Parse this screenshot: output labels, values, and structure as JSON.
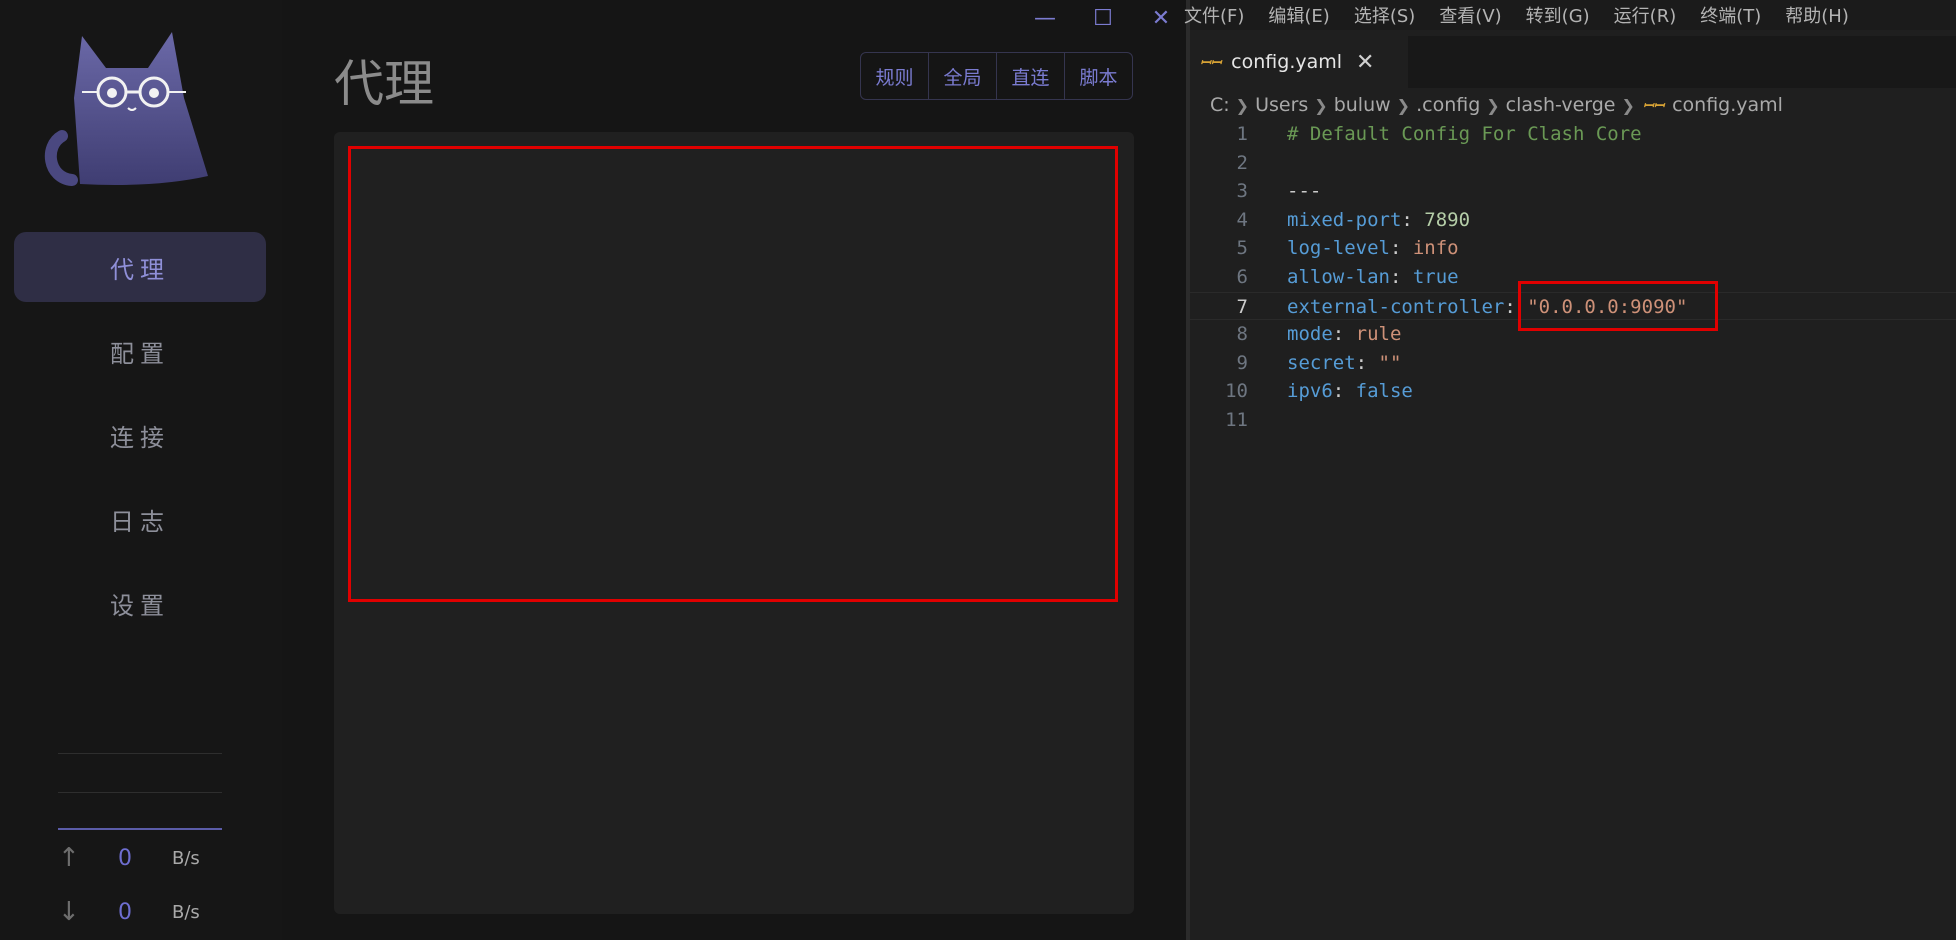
{
  "clash": {
    "window_controls": [
      "—",
      "☐",
      "✕"
    ],
    "nav": [
      {
        "label": "代理",
        "active": true
      },
      {
        "label": "配置",
        "active": false
      },
      {
        "label": "连接",
        "active": false
      },
      {
        "label": "日志",
        "active": false
      },
      {
        "label": "设置",
        "active": false
      }
    ],
    "traffic": {
      "upload": {
        "arrow": "↑",
        "value": "0",
        "unit": "B/s"
      },
      "download": {
        "arrow": "↓",
        "value": "0",
        "unit": "B/s"
      }
    },
    "page_title": "代理",
    "modes": [
      "规则",
      "全局",
      "直连",
      "脚本"
    ],
    "colors": {
      "accent": "#7a7bd0",
      "highlight": "#e00000"
    }
  },
  "vscode": {
    "menu": [
      "文件(F)",
      "编辑(E)",
      "选择(S)",
      "查看(V)",
      "转到(G)",
      "运行(R)",
      "终端(T)",
      "帮助(H)"
    ],
    "tab": {
      "icon": "yml-icon",
      "label": "config.yaml",
      "close": "✕"
    },
    "breadcrumb": [
      "C:",
      "Users",
      "buluw",
      ".config",
      "clash-verge",
      "config.yaml"
    ],
    "code": [
      {
        "n": "1",
        "tokens": [
          {
            "t": "# Default Config For Clash Core",
            "c": "comment"
          }
        ]
      },
      {
        "n": "2",
        "tokens": []
      },
      {
        "n": "3",
        "tokens": [
          {
            "t": "---",
            "c": "plain"
          }
        ]
      },
      {
        "n": "4",
        "tokens": [
          {
            "t": "mixed-port",
            "c": "key"
          },
          {
            "t": ": ",
            "c": "plain"
          },
          {
            "t": "7890",
            "c": "num"
          }
        ]
      },
      {
        "n": "5",
        "tokens": [
          {
            "t": "log-level",
            "c": "key"
          },
          {
            "t": ": ",
            "c": "plain"
          },
          {
            "t": "info",
            "c": "str"
          }
        ]
      },
      {
        "n": "6",
        "tokens": [
          {
            "t": "allow-lan",
            "c": "key"
          },
          {
            "t": ": ",
            "c": "plain"
          },
          {
            "t": "true",
            "c": "kw"
          }
        ]
      },
      {
        "n": "7",
        "tokens": [
          {
            "t": "external-controller",
            "c": "key"
          },
          {
            "t": ": ",
            "c": "plain"
          },
          {
            "t": "\"0.0.0.0:9090\"",
            "c": "str"
          }
        ],
        "current": true
      },
      {
        "n": "8",
        "tokens": [
          {
            "t": "mode",
            "c": "key"
          },
          {
            "t": ": ",
            "c": "plain"
          },
          {
            "t": "rule",
            "c": "str"
          }
        ]
      },
      {
        "n": "9",
        "tokens": [
          {
            "t": "secret",
            "c": "key"
          },
          {
            "t": ": ",
            "c": "plain"
          },
          {
            "t": "\"\"",
            "c": "str"
          }
        ]
      },
      {
        "n": "10",
        "tokens": [
          {
            "t": "ipv6",
            "c": "key"
          },
          {
            "t": ": ",
            "c": "plain"
          },
          {
            "t": "false",
            "c": "kw"
          }
        ]
      },
      {
        "n": "11",
        "tokens": []
      }
    ]
  }
}
